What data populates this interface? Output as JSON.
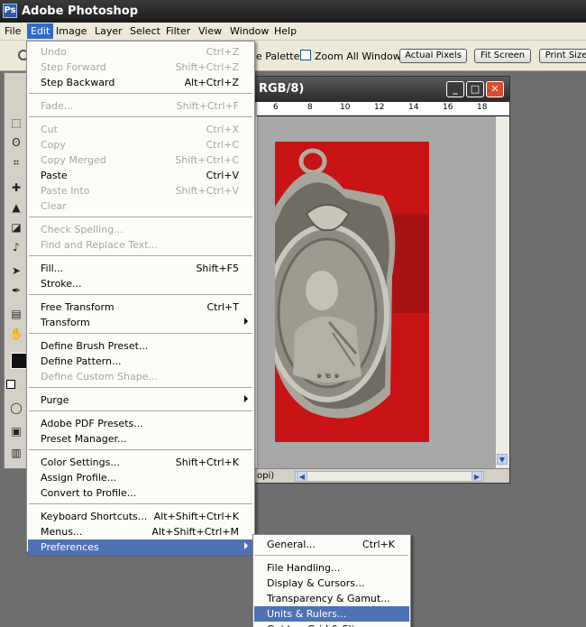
{
  "app": {
    "title": "Adobe Photoshop",
    "logo_text": "Ps"
  },
  "menubar": [
    "File",
    "Edit",
    "Image",
    "Layer",
    "Select",
    "Filter",
    "View",
    "Window",
    "Help"
  ],
  "options_bar": {
    "palettes_label": "e Palettes",
    "zoom_all_windows": "Zoom All Windows",
    "zoom_all_checked": false,
    "buttons": [
      "Actual Pixels",
      "Fit Screen",
      "Print Size"
    ]
  },
  "document": {
    "title_fragment": "RGB/8)",
    "ruler_numbers": [
      "6",
      "8",
      "10",
      "12",
      "14",
      "16",
      "18"
    ],
    "status_zoom": "opi)",
    "canvas_color": "#c81414"
  },
  "edit_menu": [
    {
      "label": "Undo",
      "shortcut": "Ctrl+Z",
      "disabled": true
    },
    {
      "label": "Step Forward",
      "shortcut": "Shift+Ctrl+Z",
      "disabled": true
    },
    {
      "label": "Step Backward",
      "shortcut": "Alt+Ctrl+Z",
      "disabled": false
    },
    {
      "sep": true
    },
    {
      "label": "Fade...",
      "shortcut": "Shift+Ctrl+F",
      "disabled": true
    },
    {
      "sep": true
    },
    {
      "label": "Cut",
      "shortcut": "Ctrl+X",
      "disabled": true
    },
    {
      "label": "Copy",
      "shortcut": "Ctrl+C",
      "disabled": true
    },
    {
      "label": "Copy Merged",
      "shortcut": "Shift+Ctrl+C",
      "disabled": true
    },
    {
      "label": "Paste",
      "shortcut": "Ctrl+V",
      "disabled": false
    },
    {
      "label": "Paste Into",
      "shortcut": "Shift+Ctrl+V",
      "disabled": true
    },
    {
      "label": "Clear",
      "shortcut": "",
      "disabled": true
    },
    {
      "sep": true
    },
    {
      "label": "Check Spelling...",
      "shortcut": "",
      "disabled": true
    },
    {
      "label": "Find and Replace Text...",
      "shortcut": "",
      "disabled": true
    },
    {
      "sep": true
    },
    {
      "label": "Fill...",
      "shortcut": "Shift+F5",
      "disabled": false
    },
    {
      "label": "Stroke...",
      "shortcut": "",
      "disabled": false
    },
    {
      "sep": true
    },
    {
      "label": "Free Transform",
      "shortcut": "Ctrl+T",
      "disabled": false
    },
    {
      "label": "Transform",
      "shortcut": "",
      "disabled": false,
      "submenu": true
    },
    {
      "sep": true
    },
    {
      "label": "Define Brush Preset...",
      "shortcut": "",
      "disabled": false
    },
    {
      "label": "Define Pattern...",
      "shortcut": "",
      "disabled": false
    },
    {
      "label": "Define Custom Shape...",
      "shortcut": "",
      "disabled": true
    },
    {
      "sep": true
    },
    {
      "label": "Purge",
      "shortcut": "",
      "disabled": false,
      "submenu": true
    },
    {
      "sep": true
    },
    {
      "label": "Adobe PDF Presets...",
      "shortcut": "",
      "disabled": false
    },
    {
      "label": "Preset Manager...",
      "shortcut": "",
      "disabled": false
    },
    {
      "sep": true
    },
    {
      "label": "Color Settings...",
      "shortcut": "Shift+Ctrl+K",
      "disabled": false
    },
    {
      "label": "Assign Profile...",
      "shortcut": "",
      "disabled": false
    },
    {
      "label": "Convert to Profile...",
      "shortcut": "",
      "disabled": false
    },
    {
      "sep": true
    },
    {
      "label": "Keyboard Shortcuts...",
      "shortcut": "Alt+Shift+Ctrl+K",
      "disabled": false
    },
    {
      "label": "Menus...",
      "shortcut": "Alt+Shift+Ctrl+M",
      "disabled": false
    },
    {
      "label": "Preferences",
      "shortcut": "",
      "disabled": false,
      "submenu": true,
      "highlighted": true
    }
  ],
  "preferences_menu": [
    {
      "label": "General...",
      "shortcut": "Ctrl+K"
    },
    {
      "sep": true
    },
    {
      "label": "File Handling...",
      "shortcut": ""
    },
    {
      "label": "Display & Cursors...",
      "shortcut": ""
    },
    {
      "label": "Transparency & Gamut...",
      "shortcut": ""
    },
    {
      "label": "Units & Rulers...",
      "shortcut": "",
      "highlighted": true
    },
    {
      "label": "Guides, Grid & Slices...",
      "shortcut": ""
    }
  ],
  "colors": {
    "menu_highlight": "#4f72b4",
    "disabled_text": "#a6a6a6"
  }
}
